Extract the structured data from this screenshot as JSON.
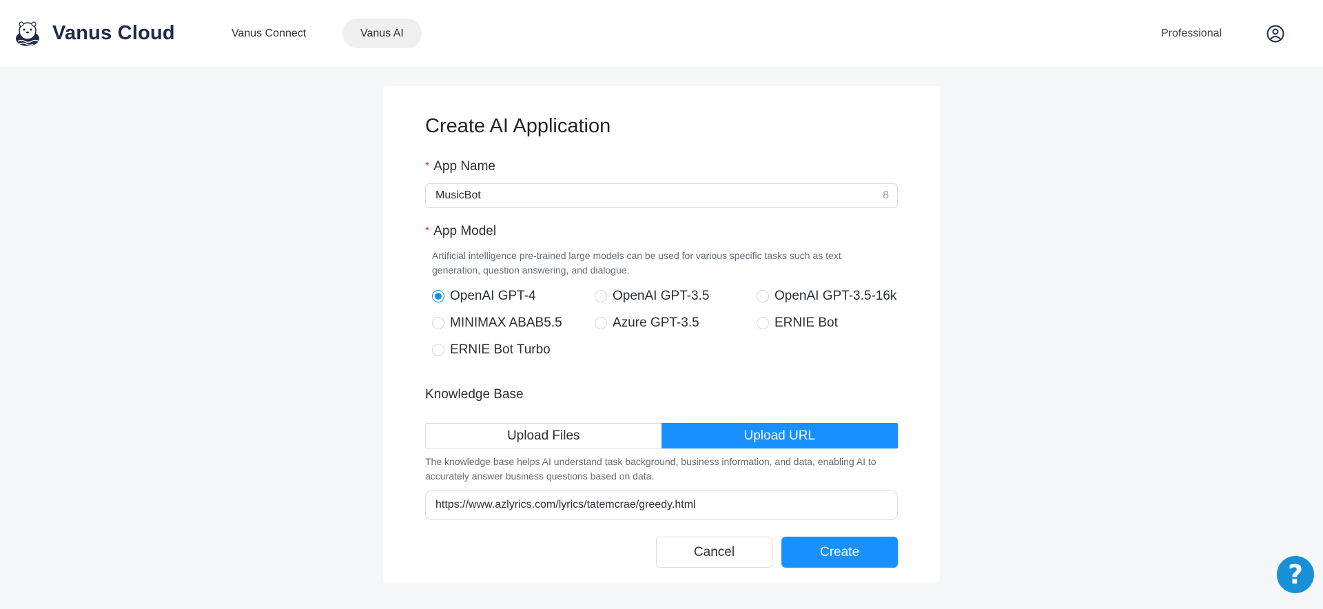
{
  "header": {
    "brand": "Vanus Cloud",
    "nav": [
      {
        "label": "Vanus Connect",
        "active": false
      },
      {
        "label": "Vanus AI",
        "active": true
      }
    ],
    "plan": "Professional",
    "icons": {
      "logo": "otter-logo",
      "user": "user-circle-icon"
    }
  },
  "form": {
    "title": "Create AI Application",
    "app_name": {
      "label": "App Name",
      "required_mark": "*",
      "value": "MusicBot",
      "char_count": "8"
    },
    "app_model": {
      "label": "App Model",
      "required_mark": "*",
      "description": "Artificial intelligence pre-trained large models can be used for various specific tasks such as text generation, question answering, and dialogue.",
      "options": [
        {
          "label": "OpenAI GPT-4",
          "selected": true
        },
        {
          "label": "OpenAI GPT-3.5",
          "selected": false
        },
        {
          "label": "OpenAI GPT-3.5-16k",
          "selected": false
        },
        {
          "label": "MINIMAX ABAB5.5",
          "selected": false
        },
        {
          "label": "Azure GPT-3.5",
          "selected": false
        },
        {
          "label": "ERNIE Bot",
          "selected": false
        },
        {
          "label": "ERNIE Bot Turbo",
          "selected": false
        }
      ]
    },
    "knowledge_base": {
      "label": "Knowledge Base",
      "tabs": [
        {
          "label": "Upload Files",
          "active": false
        },
        {
          "label": "Upload URL",
          "active": true
        }
      ],
      "description": "The knowledge base helps AI understand task background, business information, and data, enabling AI to accurately answer business questions based on data.",
      "url_value": "https://www.azlyrics.com/lyrics/tatemcrae/greedy.html"
    },
    "buttons": {
      "cancel": "Cancel",
      "create": "Create"
    }
  },
  "help": {
    "glyph": "?",
    "icon": "help-icon"
  },
  "colors": {
    "primary": "#1890ff",
    "required": "#e0364f",
    "brand_text": "#1e2a4a",
    "help": "#1890d8"
  }
}
